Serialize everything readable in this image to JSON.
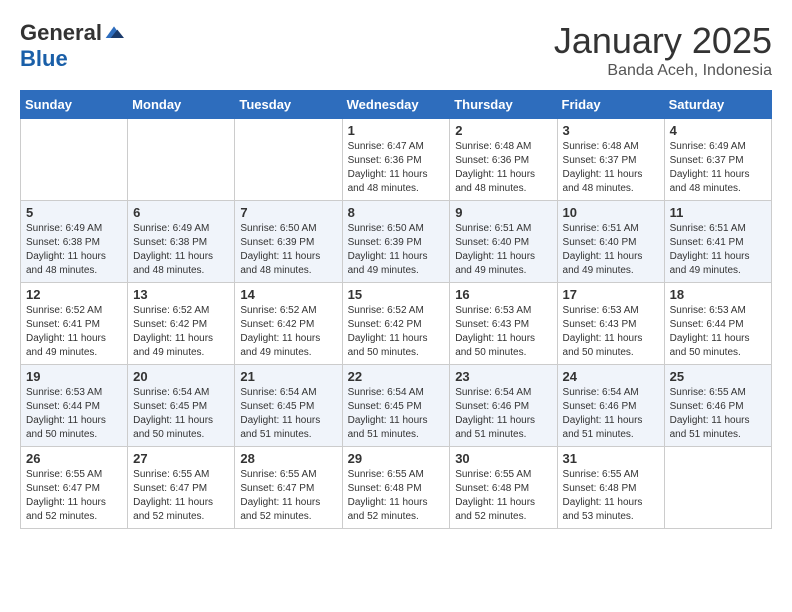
{
  "header": {
    "logo_general": "General",
    "logo_blue": "Blue",
    "month": "January 2025",
    "location": "Banda Aceh, Indonesia"
  },
  "days_of_week": [
    "Sunday",
    "Monday",
    "Tuesday",
    "Wednesday",
    "Thursday",
    "Friday",
    "Saturday"
  ],
  "weeks": [
    [
      {
        "day": "",
        "info": ""
      },
      {
        "day": "",
        "info": ""
      },
      {
        "day": "",
        "info": ""
      },
      {
        "day": "1",
        "info": "Sunrise: 6:47 AM\nSunset: 6:36 PM\nDaylight: 11 hours and 48 minutes."
      },
      {
        "day": "2",
        "info": "Sunrise: 6:48 AM\nSunset: 6:36 PM\nDaylight: 11 hours and 48 minutes."
      },
      {
        "day": "3",
        "info": "Sunrise: 6:48 AM\nSunset: 6:37 PM\nDaylight: 11 hours and 48 minutes."
      },
      {
        "day": "4",
        "info": "Sunrise: 6:49 AM\nSunset: 6:37 PM\nDaylight: 11 hours and 48 minutes."
      }
    ],
    [
      {
        "day": "5",
        "info": "Sunrise: 6:49 AM\nSunset: 6:38 PM\nDaylight: 11 hours and 48 minutes."
      },
      {
        "day": "6",
        "info": "Sunrise: 6:49 AM\nSunset: 6:38 PM\nDaylight: 11 hours and 48 minutes."
      },
      {
        "day": "7",
        "info": "Sunrise: 6:50 AM\nSunset: 6:39 PM\nDaylight: 11 hours and 48 minutes."
      },
      {
        "day": "8",
        "info": "Sunrise: 6:50 AM\nSunset: 6:39 PM\nDaylight: 11 hours and 49 minutes."
      },
      {
        "day": "9",
        "info": "Sunrise: 6:51 AM\nSunset: 6:40 PM\nDaylight: 11 hours and 49 minutes."
      },
      {
        "day": "10",
        "info": "Sunrise: 6:51 AM\nSunset: 6:40 PM\nDaylight: 11 hours and 49 minutes."
      },
      {
        "day": "11",
        "info": "Sunrise: 6:51 AM\nSunset: 6:41 PM\nDaylight: 11 hours and 49 minutes."
      }
    ],
    [
      {
        "day": "12",
        "info": "Sunrise: 6:52 AM\nSunset: 6:41 PM\nDaylight: 11 hours and 49 minutes."
      },
      {
        "day": "13",
        "info": "Sunrise: 6:52 AM\nSunset: 6:42 PM\nDaylight: 11 hours and 49 minutes."
      },
      {
        "day": "14",
        "info": "Sunrise: 6:52 AM\nSunset: 6:42 PM\nDaylight: 11 hours and 49 minutes."
      },
      {
        "day": "15",
        "info": "Sunrise: 6:52 AM\nSunset: 6:42 PM\nDaylight: 11 hours and 50 minutes."
      },
      {
        "day": "16",
        "info": "Sunrise: 6:53 AM\nSunset: 6:43 PM\nDaylight: 11 hours and 50 minutes."
      },
      {
        "day": "17",
        "info": "Sunrise: 6:53 AM\nSunset: 6:43 PM\nDaylight: 11 hours and 50 minutes."
      },
      {
        "day": "18",
        "info": "Sunrise: 6:53 AM\nSunset: 6:44 PM\nDaylight: 11 hours and 50 minutes."
      }
    ],
    [
      {
        "day": "19",
        "info": "Sunrise: 6:53 AM\nSunset: 6:44 PM\nDaylight: 11 hours and 50 minutes."
      },
      {
        "day": "20",
        "info": "Sunrise: 6:54 AM\nSunset: 6:45 PM\nDaylight: 11 hours and 50 minutes."
      },
      {
        "day": "21",
        "info": "Sunrise: 6:54 AM\nSunset: 6:45 PM\nDaylight: 11 hours and 51 minutes."
      },
      {
        "day": "22",
        "info": "Sunrise: 6:54 AM\nSunset: 6:45 PM\nDaylight: 11 hours and 51 minutes."
      },
      {
        "day": "23",
        "info": "Sunrise: 6:54 AM\nSunset: 6:46 PM\nDaylight: 11 hours and 51 minutes."
      },
      {
        "day": "24",
        "info": "Sunrise: 6:54 AM\nSunset: 6:46 PM\nDaylight: 11 hours and 51 minutes."
      },
      {
        "day": "25",
        "info": "Sunrise: 6:55 AM\nSunset: 6:46 PM\nDaylight: 11 hours and 51 minutes."
      }
    ],
    [
      {
        "day": "26",
        "info": "Sunrise: 6:55 AM\nSunset: 6:47 PM\nDaylight: 11 hours and 52 minutes."
      },
      {
        "day": "27",
        "info": "Sunrise: 6:55 AM\nSunset: 6:47 PM\nDaylight: 11 hours and 52 minutes."
      },
      {
        "day": "28",
        "info": "Sunrise: 6:55 AM\nSunset: 6:47 PM\nDaylight: 11 hours and 52 minutes."
      },
      {
        "day": "29",
        "info": "Sunrise: 6:55 AM\nSunset: 6:48 PM\nDaylight: 11 hours and 52 minutes."
      },
      {
        "day": "30",
        "info": "Sunrise: 6:55 AM\nSunset: 6:48 PM\nDaylight: 11 hours and 52 minutes."
      },
      {
        "day": "31",
        "info": "Sunrise: 6:55 AM\nSunset: 6:48 PM\nDaylight: 11 hours and 53 minutes."
      },
      {
        "day": "",
        "info": ""
      }
    ]
  ]
}
